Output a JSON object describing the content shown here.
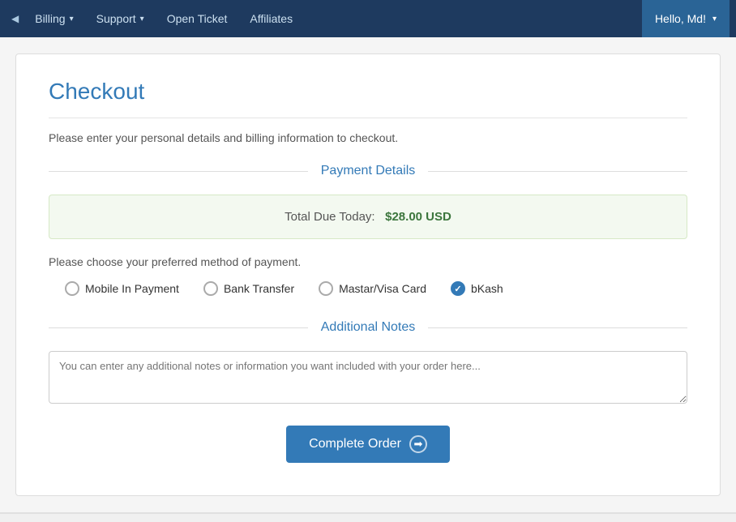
{
  "navbar": {
    "left_arrow": "◀",
    "billing_label": "Billing",
    "billing_arrow": "▾",
    "support_label": "Support",
    "support_arrow": "▾",
    "open_ticket_label": "Open Ticket",
    "affiliates_label": "Affiliates",
    "user_greeting": "Hello, Md!",
    "user_arrow": "▾"
  },
  "checkout": {
    "title": "Checkout",
    "subtitle": "Please enter your personal details and billing information to checkout.",
    "payment_details_header": "Payment Details",
    "total_label": "Total Due Today:",
    "total_amount": "$28.00 USD",
    "payment_method_prompt": "Please choose your preferred method of payment.",
    "payment_options": [
      {
        "id": "mobile",
        "label": "Mobile In Payment",
        "checked": false
      },
      {
        "id": "bank",
        "label": "Bank Transfer",
        "checked": false
      },
      {
        "id": "card",
        "label": "Mastar/Visa Card",
        "checked": false
      },
      {
        "id": "bkash",
        "label": "bKash",
        "checked": true
      }
    ],
    "additional_notes_header": "Additional Notes",
    "notes_placeholder": "You can enter any additional notes or information you want included with your order here...",
    "complete_order_label": "Complete Order"
  }
}
